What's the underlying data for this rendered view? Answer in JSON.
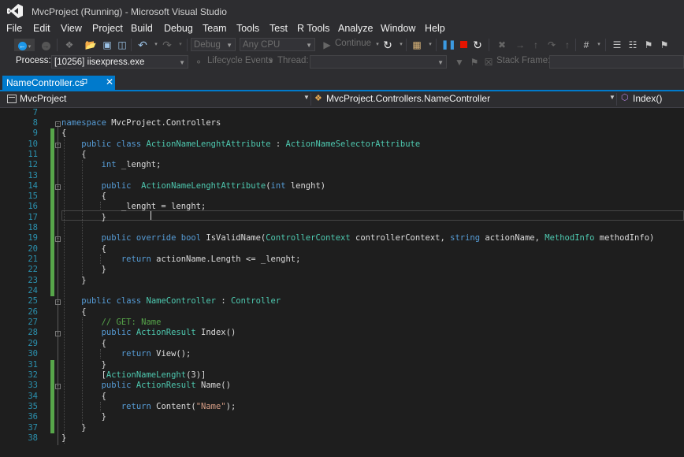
{
  "window": {
    "title": "MvcProject (Running) - Microsoft Visual Studio",
    "logo_icon": "visual-studio-logo"
  },
  "menu": [
    "File",
    "Edit",
    "View",
    "Project",
    "Build",
    "Debug",
    "Team",
    "Tools",
    "Test",
    "R Tools",
    "Analyze",
    "Window",
    "Help"
  ],
  "toolbar": {
    "config": "Debug",
    "platform": "Any CPU",
    "continue_label": "Continue",
    "icons": [
      "back-icon",
      "forward-icon",
      "new-project-icon",
      "open-icon",
      "save-icon",
      "save-all-icon",
      "undo-icon",
      "redo-icon",
      "start-icon",
      "refresh-icon",
      "break-all-icon",
      "stop-icon",
      "restart-icon",
      "show-next-statement-icon",
      "step-into-icon",
      "step-over-icon",
      "step-out-icon"
    ]
  },
  "debugbar": {
    "process_label": "Process:",
    "process_value": "[10256] iisexpress.exe",
    "lifecycle_label": "Lifecycle Events",
    "thread_label": "Thread:",
    "stackframe_label": "Stack Frame:"
  },
  "tab": {
    "filename": "NameController.cs",
    "pin": "⊐",
    "close": "✕"
  },
  "navbar": {
    "project": "MvcProject",
    "type": "MvcProject.Controllers.NameController",
    "member": "Index()"
  },
  "code": {
    "line_numbers": [
      "7",
      "8",
      "9",
      "10",
      "11",
      "12",
      "13",
      "14",
      "15",
      "16",
      "17",
      "18",
      "19",
      "20",
      "21",
      "22",
      "23",
      "24",
      "25",
      "26",
      "27",
      "28",
      "29",
      "30",
      "31",
      "32",
      "33",
      "34",
      "35",
      "36",
      "37",
      "38"
    ],
    "lines": [
      "",
      "namespace MvcProject.Controllers",
      "{",
      "    public class ActionNameLenghtAttribute : ActionNameSelectorAttribute",
      "    {",
      "        int _lenght;",
      "",
      "        public  ActionNameLenghtAttribute(int lenght)",
      "        {",
      "            _lenght = lenght;",
      "        }",
      "",
      "        public override bool IsValidName(ControllerContext controllerContext, string actionName, MethodInfo methodInfo)",
      "        {",
      "            return actionName.Length <= _lenght;",
      "        }",
      "    }",
      "",
      "    public class NameController : Controller",
      "    {",
      "        // GET: Name",
      "        public ActionResult Index()",
      "        {",
      "            return View();",
      "        }",
      "        [ActionNameLenght(3)]",
      "        public ActionResult Name()",
      "        {",
      "            return Content(\"Name\");",
      "        }",
      "    }",
      "}"
    ]
  },
  "colors": {
    "keyword": "#569cd6",
    "type": "#4ec9b0",
    "comment": "#57a64a",
    "string": "#d69d85",
    "line_number": "#2b91af",
    "accent": "#007acc"
  }
}
